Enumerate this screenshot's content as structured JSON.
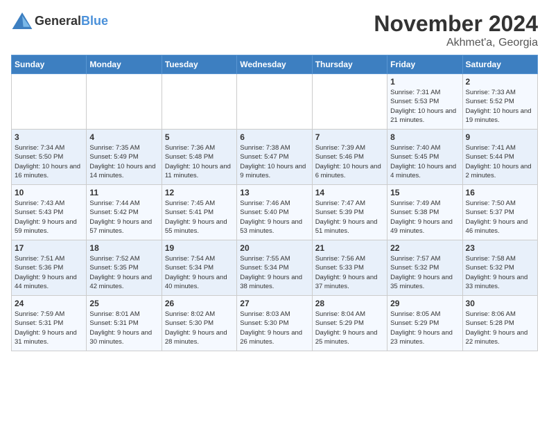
{
  "logo": {
    "text_general": "General",
    "text_blue": "Blue"
  },
  "header": {
    "month": "November 2024",
    "location": "Akhmet'a, Georgia"
  },
  "weekdays": [
    "Sunday",
    "Monday",
    "Tuesday",
    "Wednesday",
    "Thursday",
    "Friday",
    "Saturday"
  ],
  "weeks": [
    [
      {
        "day": "",
        "info": ""
      },
      {
        "day": "",
        "info": ""
      },
      {
        "day": "",
        "info": ""
      },
      {
        "day": "",
        "info": ""
      },
      {
        "day": "",
        "info": ""
      },
      {
        "day": "1",
        "info": "Sunrise: 7:31 AM\nSunset: 5:53 PM\nDaylight: 10 hours and 21 minutes."
      },
      {
        "day": "2",
        "info": "Sunrise: 7:33 AM\nSunset: 5:52 PM\nDaylight: 10 hours and 19 minutes."
      }
    ],
    [
      {
        "day": "3",
        "info": "Sunrise: 7:34 AM\nSunset: 5:50 PM\nDaylight: 10 hours and 16 minutes."
      },
      {
        "day": "4",
        "info": "Sunrise: 7:35 AM\nSunset: 5:49 PM\nDaylight: 10 hours and 14 minutes."
      },
      {
        "day": "5",
        "info": "Sunrise: 7:36 AM\nSunset: 5:48 PM\nDaylight: 10 hours and 11 minutes."
      },
      {
        "day": "6",
        "info": "Sunrise: 7:38 AM\nSunset: 5:47 PM\nDaylight: 10 hours and 9 minutes."
      },
      {
        "day": "7",
        "info": "Sunrise: 7:39 AM\nSunset: 5:46 PM\nDaylight: 10 hours and 6 minutes."
      },
      {
        "day": "8",
        "info": "Sunrise: 7:40 AM\nSunset: 5:45 PM\nDaylight: 10 hours and 4 minutes."
      },
      {
        "day": "9",
        "info": "Sunrise: 7:41 AM\nSunset: 5:44 PM\nDaylight: 10 hours and 2 minutes."
      }
    ],
    [
      {
        "day": "10",
        "info": "Sunrise: 7:43 AM\nSunset: 5:43 PM\nDaylight: 9 hours and 59 minutes."
      },
      {
        "day": "11",
        "info": "Sunrise: 7:44 AM\nSunset: 5:42 PM\nDaylight: 9 hours and 57 minutes."
      },
      {
        "day": "12",
        "info": "Sunrise: 7:45 AM\nSunset: 5:41 PM\nDaylight: 9 hours and 55 minutes."
      },
      {
        "day": "13",
        "info": "Sunrise: 7:46 AM\nSunset: 5:40 PM\nDaylight: 9 hours and 53 minutes."
      },
      {
        "day": "14",
        "info": "Sunrise: 7:47 AM\nSunset: 5:39 PM\nDaylight: 9 hours and 51 minutes."
      },
      {
        "day": "15",
        "info": "Sunrise: 7:49 AM\nSunset: 5:38 PM\nDaylight: 9 hours and 49 minutes."
      },
      {
        "day": "16",
        "info": "Sunrise: 7:50 AM\nSunset: 5:37 PM\nDaylight: 9 hours and 46 minutes."
      }
    ],
    [
      {
        "day": "17",
        "info": "Sunrise: 7:51 AM\nSunset: 5:36 PM\nDaylight: 9 hours and 44 minutes."
      },
      {
        "day": "18",
        "info": "Sunrise: 7:52 AM\nSunset: 5:35 PM\nDaylight: 9 hours and 42 minutes."
      },
      {
        "day": "19",
        "info": "Sunrise: 7:54 AM\nSunset: 5:34 PM\nDaylight: 9 hours and 40 minutes."
      },
      {
        "day": "20",
        "info": "Sunrise: 7:55 AM\nSunset: 5:34 PM\nDaylight: 9 hours and 38 minutes."
      },
      {
        "day": "21",
        "info": "Sunrise: 7:56 AM\nSunset: 5:33 PM\nDaylight: 9 hours and 37 minutes."
      },
      {
        "day": "22",
        "info": "Sunrise: 7:57 AM\nSunset: 5:32 PM\nDaylight: 9 hours and 35 minutes."
      },
      {
        "day": "23",
        "info": "Sunrise: 7:58 AM\nSunset: 5:32 PM\nDaylight: 9 hours and 33 minutes."
      }
    ],
    [
      {
        "day": "24",
        "info": "Sunrise: 7:59 AM\nSunset: 5:31 PM\nDaylight: 9 hours and 31 minutes."
      },
      {
        "day": "25",
        "info": "Sunrise: 8:01 AM\nSunset: 5:31 PM\nDaylight: 9 hours and 30 minutes."
      },
      {
        "day": "26",
        "info": "Sunrise: 8:02 AM\nSunset: 5:30 PM\nDaylight: 9 hours and 28 minutes."
      },
      {
        "day": "27",
        "info": "Sunrise: 8:03 AM\nSunset: 5:30 PM\nDaylight: 9 hours and 26 minutes."
      },
      {
        "day": "28",
        "info": "Sunrise: 8:04 AM\nSunset: 5:29 PM\nDaylight: 9 hours and 25 minutes."
      },
      {
        "day": "29",
        "info": "Sunrise: 8:05 AM\nSunset: 5:29 PM\nDaylight: 9 hours and 23 minutes."
      },
      {
        "day": "30",
        "info": "Sunrise: 8:06 AM\nSunset: 5:28 PM\nDaylight: 9 hours and 22 minutes."
      }
    ]
  ]
}
